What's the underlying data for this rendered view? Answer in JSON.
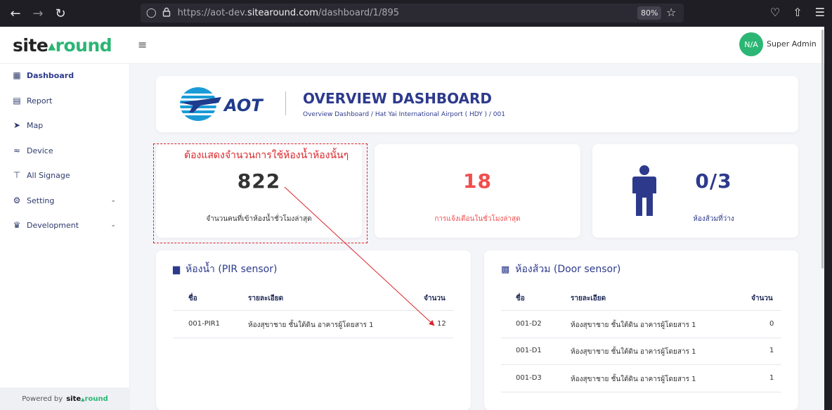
{
  "browser": {
    "url_prefix": "https://aot-dev.",
    "url_domain": "sitearound.com",
    "url_suffix": "/dashboard/1/895",
    "zoom": "80%"
  },
  "header": {
    "logo_site": "site",
    "logo_round": "round",
    "avatar": "N/A",
    "user": "Super Admin"
  },
  "sidebar": {
    "items": [
      {
        "label": "Dashboard",
        "icon": "grid-icon"
      },
      {
        "label": "Report",
        "icon": "report-icon"
      },
      {
        "label": "Map",
        "icon": "navigation-icon"
      },
      {
        "label": "Device",
        "icon": "wifi-icon"
      },
      {
        "label": "All Signage",
        "icon": "signage-icon"
      },
      {
        "label": "Setting",
        "icon": "gear-icon"
      },
      {
        "label": "Development",
        "icon": "development-icon"
      }
    ],
    "powered_by": "Powered by",
    "powered_site": "site",
    "powered_round": "round"
  },
  "title_card": {
    "logo_text": "AOT",
    "title": "OVERVIEW DASHBOARD",
    "breadcrumb": "Overview Dashboard / Hat Yai International Airport ( HDY ) / 001"
  },
  "stats": [
    {
      "value": "822",
      "label": "จำนวนคนที่เข้าห้องน้ำชั่วโมงล่าสุด",
      "color": "#333333"
    },
    {
      "value": "18",
      "label": "การแจ้งเตือนในชั่วโมงล่าสุด",
      "color": "#f04e4e"
    },
    {
      "value": "0/3",
      "label": "ห้องส้วมที่ว่าง",
      "color": "#2d3a8c"
    }
  ],
  "pir_table": {
    "title": "ห้องน้ำ (PIR sensor)",
    "headers": [
      "ชื่อ",
      "รายละเอียด",
      "จำนวน"
    ],
    "rows": [
      [
        "001-PIR1",
        "ห้องสุขาชาย ชั้นใต้ดิน อาคารผู้โดยสาร 1",
        "12"
      ]
    ]
  },
  "door_table": {
    "title": "ห้องส้วม (Door sensor)",
    "headers": [
      "ชื่อ",
      "รายละเอียด",
      "จำนวน"
    ],
    "rows": [
      [
        "001-D2",
        "ห้องสุขาชาย ชั้นใต้ดิน อาคารผู้โดยสาร 1",
        "0"
      ],
      [
        "001-D1",
        "ห้องสุขาชาย ชั้นใต้ดิน อาคารผู้โดยสาร 1",
        "1"
      ],
      [
        "001-D3",
        "ห้องสุขาชาย ชั้นใต้ดิน อาคารผู้โดยสาร 1",
        "1"
      ]
    ]
  },
  "annotation": {
    "text": "ต้องแสดงจำนวนการใช้ห้องน้ำห้องนั้นๆ",
    "color": "#d9262b"
  }
}
